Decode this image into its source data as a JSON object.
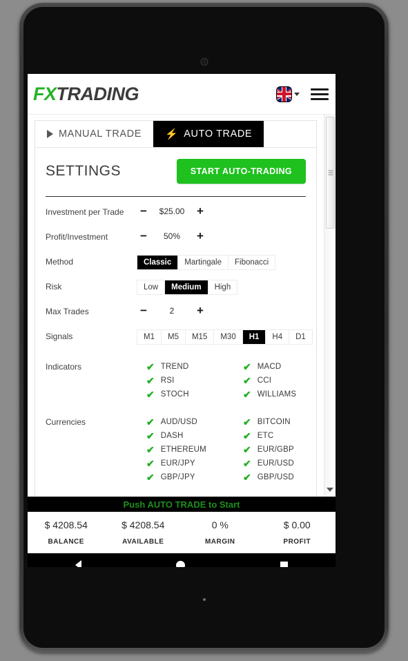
{
  "app": {
    "logo_fx": "FX",
    "logo_trading": "TRADING",
    "flag_icon": "uk-flag-icon",
    "caret_icon": "chevron-down-icon",
    "menu_icon": "hamburger-menu-icon"
  },
  "tabs": [
    {
      "label": "MANUAL TRADE",
      "icon": "play-triangle-icon",
      "active": false
    },
    {
      "label": "AUTO TRADE",
      "icon": "lightning-bolt-icon",
      "active": true
    }
  ],
  "settings": {
    "title": "SETTINGS",
    "start_button": "START AUTO-TRADING",
    "start_button_color": "#1ec11e",
    "rows": {
      "investment": {
        "label": "Investment per Trade",
        "value": "$25.00",
        "minus": "−",
        "plus": "+"
      },
      "profit": {
        "label": "Profit/Investment",
        "value": "50%",
        "minus": "−",
        "plus": "+"
      },
      "method": {
        "label": "Method",
        "options": [
          "Classic",
          "Martingale",
          "Fibonacci"
        ],
        "selected": "Classic"
      },
      "risk": {
        "label": "Risk",
        "options": [
          "Low",
          "Medium",
          "High"
        ],
        "selected": "Medium"
      },
      "max_trades": {
        "label": "Max Trades",
        "value": "2",
        "minus": "−",
        "plus": "+"
      },
      "signals": {
        "label": "Signals",
        "options": [
          "M1",
          "M5",
          "M15",
          "M30",
          "H1",
          "H4",
          "D1"
        ],
        "selected": "H1"
      },
      "indicators": {
        "label": "Indicators",
        "check_color": "#22b022",
        "col1": [
          "TREND",
          "RSI",
          "STOCH"
        ],
        "col2": [
          "MACD",
          "CCI",
          "WILLIAMS"
        ]
      },
      "currencies": {
        "label": "Currencies",
        "check_color": "#22b022",
        "col1": [
          "AUD/USD",
          "DASH",
          "ETHEREUM",
          "EUR/JPY",
          "GBP/JPY"
        ],
        "col2": [
          "BITCOIN",
          "ETC",
          "EUR/GBP",
          "EUR/USD",
          "GBP/USD"
        ]
      }
    }
  },
  "status": {
    "push_message": "Push AUTO TRADE to Start",
    "push_color": "#1d8f1d",
    "stats": [
      {
        "value": "$ 4208.54",
        "key": "BALANCE"
      },
      {
        "value": "$ 4208.54",
        "key": "AVAILABLE"
      },
      {
        "value": "0 %",
        "key": "MARGIN"
      },
      {
        "value": "$ 0.00",
        "key": "PROFIT"
      }
    ]
  },
  "navbar": {
    "back": "back-button",
    "home": "home-button",
    "recent": "recent-apps-button"
  },
  "scrollbar": {
    "down_arrow": "scroll-down-arrow"
  }
}
